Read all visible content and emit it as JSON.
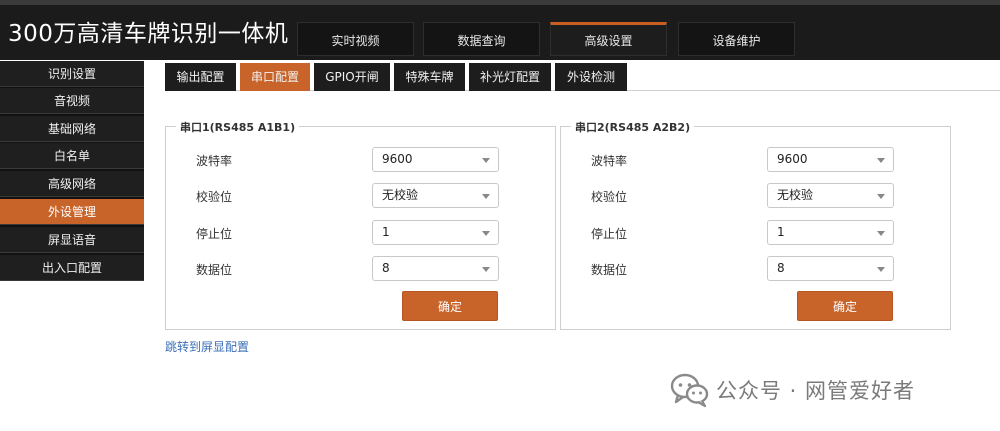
{
  "header": {
    "title": "300万高清车牌识别一体机",
    "tabs": [
      "实时视频",
      "数据查询",
      "高级设置",
      "设备维护"
    ],
    "active_tab": 2
  },
  "sidebar": {
    "items": [
      "识别设置",
      "音视频",
      "基础网络",
      "白名单",
      "高级网络",
      "外设管理",
      "屏显语音",
      "出入口配置"
    ],
    "active_index": 5
  },
  "subtabs": {
    "items": [
      "输出配置",
      "串口配置",
      "GPIO开闸",
      "特殊车牌",
      "补光灯配置",
      "外设检测"
    ],
    "active_index": 1
  },
  "ports": [
    {
      "legend": "串口1(RS485 A1B1)",
      "fields": [
        {
          "label": "波特率",
          "value": "9600"
        },
        {
          "label": "校验位",
          "value": "无校验"
        },
        {
          "label": "停止位",
          "value": "1"
        },
        {
          "label": "数据位",
          "value": "8"
        }
      ],
      "confirm_label": "确定"
    },
    {
      "legend": "串口2(RS485 A2B2)",
      "fields": [
        {
          "label": "波特率",
          "value": "9600"
        },
        {
          "label": "校验位",
          "value": "无校验"
        },
        {
          "label": "停止位",
          "value": "1"
        },
        {
          "label": "数据位",
          "value": "8"
        }
      ],
      "confirm_label": "确定"
    }
  ],
  "link_text": "跳转到屏显配置",
  "watermark": "公众号 · 网管爱好者",
  "colors": {
    "accent": "#c8632a",
    "dark": "#1d1d1d",
    "link": "#3b6fb6"
  }
}
